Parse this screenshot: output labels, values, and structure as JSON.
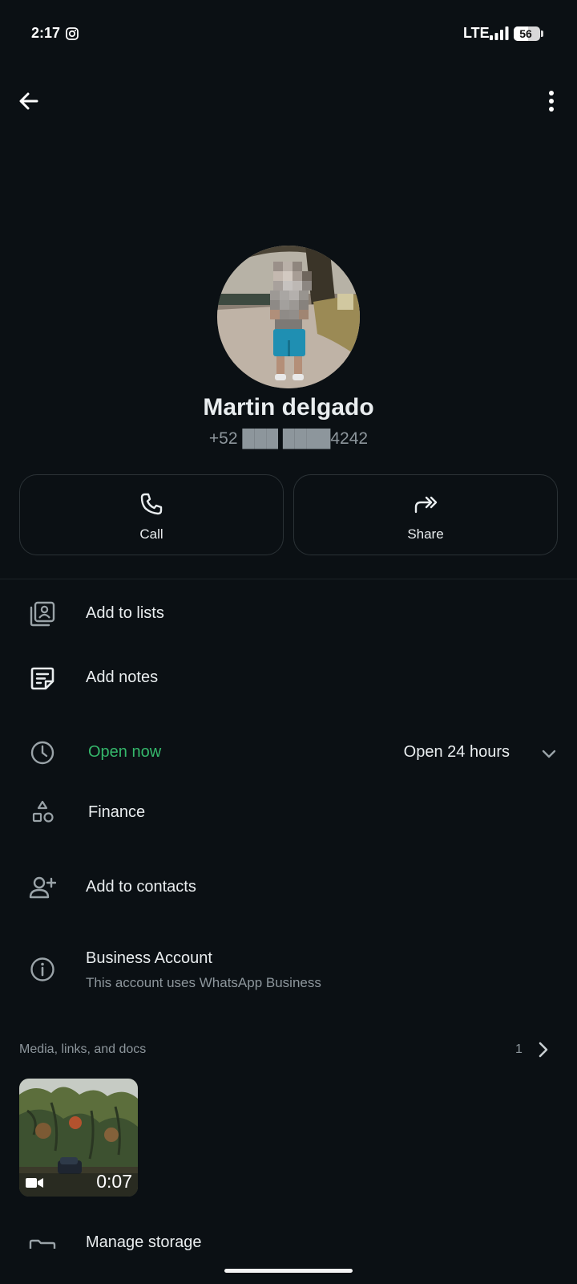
{
  "status_bar": {
    "time": "2:17",
    "network": "LTE",
    "battery": "56",
    "battery_level": 0.56
  },
  "header": {
    "back_icon": "arrow-left-icon",
    "menu_icon": "more-vertical-icon"
  },
  "profile": {
    "name": "Martin delgado",
    "phone": "+52 ███ ████4242"
  },
  "actions": {
    "call_label": "Call",
    "share_label": "Share"
  },
  "rows": {
    "lists_label": "Add to lists",
    "notes_label": "Add notes",
    "hours_status": "Open now",
    "hours_value": "Open 24 hours",
    "category_label": "Finance",
    "add_contact_label": "Add to contacts",
    "business_title": "Business Account",
    "business_subtitle": "This account uses WhatsApp Business",
    "storage_label": "Manage storage"
  },
  "media": {
    "title": "Media, links, and docs",
    "count": "1",
    "video_duration": "0:07"
  },
  "colors": {
    "background": "#0b1014",
    "accent_green": "#35b76b",
    "secondary_text": "#8d969c"
  }
}
